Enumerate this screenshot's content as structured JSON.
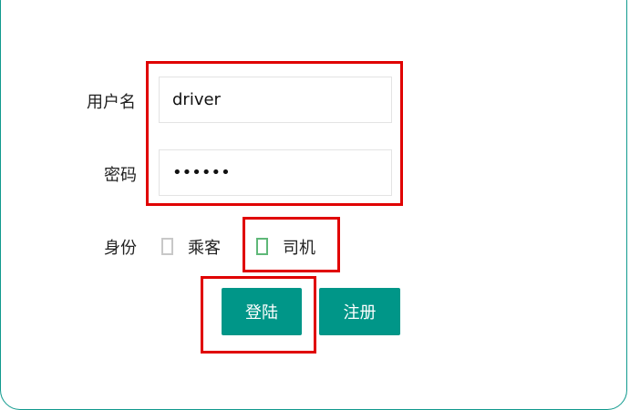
{
  "form": {
    "username_label": "用户名",
    "username_value": "driver",
    "password_label": "密码",
    "password_value": "••••••",
    "role_label": "身份",
    "role_options": [
      {
        "label": "乘客",
        "checked": false
      },
      {
        "label": "司机",
        "checked": true
      }
    ],
    "login_label": "登陆",
    "register_label": "注册"
  },
  "colors": {
    "primary": "#009688",
    "border_accent": "#109a8e",
    "checked": "#5fb878",
    "highlight": "#e00000"
  }
}
